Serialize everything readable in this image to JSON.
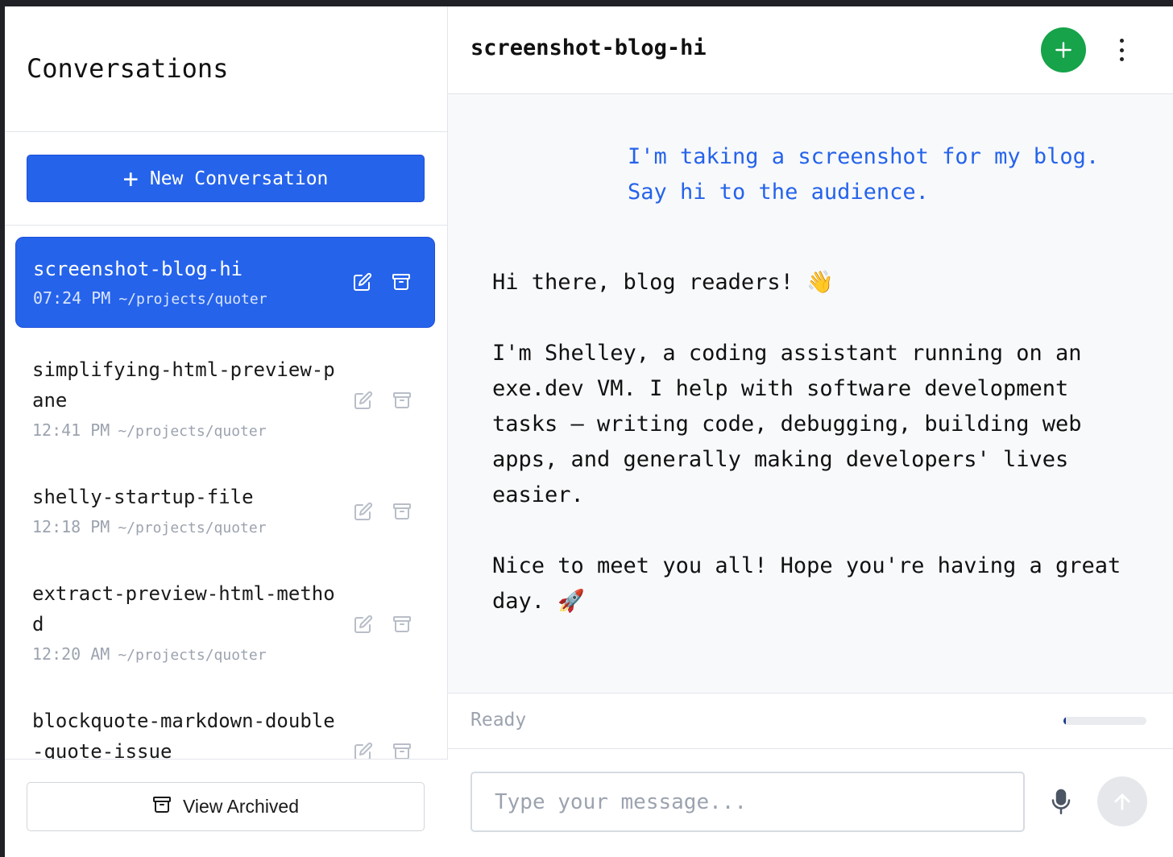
{
  "sidebar": {
    "title": "Conversations",
    "new_button_label": "New Conversation",
    "new_button_icon": "plus-icon",
    "conversations": [
      {
        "title": "screenshot-blog-hi",
        "time": "07:24 PM",
        "path": "~/projects/quoter",
        "active": true
      },
      {
        "title": "simplifying-html-preview-pane",
        "time": "12:41 PM",
        "path": "~/projects/quoter",
        "active": false
      },
      {
        "title": "shelly-startup-file",
        "time": "12:18 PM",
        "path": "~/projects/quoter",
        "active": false
      },
      {
        "title": "extract-preview-html-method",
        "time": "12:20 AM",
        "path": "~/projects/quoter",
        "active": false
      },
      {
        "title": "blockquote-markdown-double-quote-issue",
        "time": "",
        "path": "",
        "active": false
      }
    ],
    "view_archived_label": "View Archived"
  },
  "main": {
    "title": "screenshot-blog-hi",
    "user_message": "I'm taking a screenshot for my blog. Say hi to the audience.",
    "assistant_message": {
      "p1": "Hi there, blog readers! 👋",
      "p2": "I'm Shelley, a coding assistant running on an exe.dev VM. I help with software development tasks — writing code, debugging, building web apps, and generally making developers' lives easier.",
      "p3": "Nice to meet you all! Hope you're having a great day. 🚀"
    },
    "status": "Ready",
    "progress_fraction": 0.03,
    "input_placeholder": "Type your message...",
    "input_value": ""
  },
  "colors": {
    "accent": "#2563eb",
    "new_chat": "#16a34a",
    "user_text": "#2563eb"
  }
}
